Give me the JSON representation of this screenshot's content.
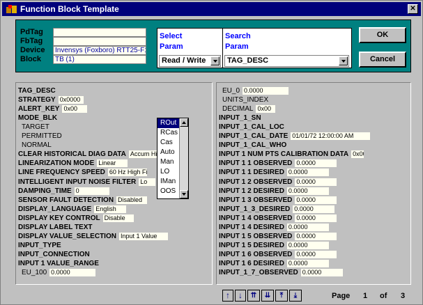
{
  "window": {
    "title": "Function Block Template",
    "close": "✕"
  },
  "header": {
    "pdtag_label": "PdTag",
    "fbtag_label": "FbTag",
    "device_label": "Device",
    "block_label": "Block",
    "pdtag_value": "",
    "fbtag_value": "",
    "device_value": "Invensys (Foxboro) RTT25-F1.",
    "block_value": "TB (1)",
    "select_head1": "Select",
    "select_head2": "Param",
    "select_value": "Read / Write",
    "search_head1": "Search",
    "search_head2": "Param",
    "search_value": "TAG_DESC",
    "ok": "OK",
    "cancel": "Cancel"
  },
  "left": [
    {
      "label": "TAG_DESC",
      "value": "",
      "bold": true
    },
    {
      "label": "STRATEGY",
      "value": "0x0000",
      "bold": true
    },
    {
      "label": "ALERT_KEY",
      "value": "0x00",
      "bold": true
    },
    {
      "label": "MODE_BLK",
      "value": "",
      "bold": true
    },
    {
      "label": "TARGET",
      "value": "",
      "bold": false
    },
    {
      "label": "PERMITTED",
      "value": "",
      "bold": false
    },
    {
      "label": "NORMAL",
      "value": "",
      "bold": false
    },
    {
      "label": "CLEAR HISTORICAL DIAG DATA",
      "value": "Accum Historica",
      "bold": true
    },
    {
      "label": "LINEARIZATION MODE",
      "value": "Linear",
      "bold": true
    },
    {
      "label": "LINE FREQUENCY SPEED",
      "value": "60 Hz High Fi",
      "bold": true
    },
    {
      "label": "INTELLIGENT INPUT NOISE FILTER",
      "value": "Lo",
      "bold": true
    },
    {
      "label": "DAMPING_TIME",
      "value": "0",
      "bold": true
    },
    {
      "label": "SENSOR FAULT DETECTION",
      "value": "Disabled",
      "bold": true
    },
    {
      "label": "DISPLAY_LANGUAGE",
      "value": "English",
      "bold": true
    },
    {
      "label": "DISPLAY KEY CONTROL",
      "value": "Disable",
      "bold": true
    },
    {
      "label": "DISPLAY LABEL TEXT",
      "value": "",
      "bold": true
    },
    {
      "label": "DISPLAY VALUE_SELECTION",
      "value": "Input 1 Value",
      "bold": true
    },
    {
      "label": "INPUT_TYPE",
      "value": "",
      "bold": true
    },
    {
      "label": "INPUT_CONNECTION",
      "value": "",
      "bold": true
    },
    {
      "label": "INPUT 1 VALUE_RANGE",
      "value": "",
      "bold": true
    },
    {
      "label": "EU_100",
      "value": "0.0000",
      "bold": false
    }
  ],
  "right": [
    {
      "label": "EU_0",
      "value": "0.0000",
      "bold": false
    },
    {
      "label": "UNITS_INDEX",
      "value": "",
      "bold": false
    },
    {
      "label": "DECIMAL",
      "value": "0x00",
      "bold": false
    },
    {
      "label": "INPUT_1_SN",
      "value": "",
      "bold": true
    },
    {
      "label": "INPUT_1_CAL_LOC",
      "value": "",
      "bold": true
    },
    {
      "label": "INPUT_1_CAL_DATE",
      "value": "01/01/72 12:00:00 AM",
      "bold": true
    },
    {
      "label": "INPUT_1_CAL_WHO",
      "value": "",
      "bold": true
    },
    {
      "label": "INPUT 1 NUM PTS CALIBRATION DATA",
      "value": "0x00",
      "bold": true
    },
    {
      "label": "INPUT 1 1 OBSERVED",
      "value": "0.0000",
      "bold": true
    },
    {
      "label": "INPUT 1 1 DESIRED",
      "value": "0.0000",
      "bold": true
    },
    {
      "label": "INPUT 1 2 OBSERVED",
      "value": "0.0000",
      "bold": true
    },
    {
      "label": "INPUT 1 2 DESIRED",
      "value": "0.0000",
      "bold": true
    },
    {
      "label": "INPUT 1 3 OBSERVED",
      "value": "0.0000",
      "bold": true
    },
    {
      "label": "INPUT_1_3_DESIRED",
      "value": "0.0000",
      "bold": true
    },
    {
      "label": "INPUT 1 4 OBSERVED",
      "value": "0.0000",
      "bold": true
    },
    {
      "label": "INPUT 1 4 DESIRED",
      "value": "0.0000",
      "bold": true
    },
    {
      "label": "INPUT 1 5 OBSERVED",
      "value": "0.0000",
      "bold": true
    },
    {
      "label": "INPUT 1 5 DESIRED",
      "value": "0.0000",
      "bold": true
    },
    {
      "label": "INPUT 1 6 OBSERVED",
      "value": "0.0000",
      "bold": true
    },
    {
      "label": "INPUT 1 6 DESIRED",
      "value": "0.0000",
      "bold": true
    },
    {
      "label": "INPUT_1_7_OBSERVED",
      "value": "0.0000",
      "bold": true
    }
  ],
  "mode_dropdown": {
    "options": [
      "ROut",
      "RCas",
      "Cas",
      "Auto",
      "Man",
      "LO",
      "IMan",
      "OOS"
    ],
    "selected": "ROut"
  },
  "pager": {
    "page_label": "Page",
    "page": "1",
    "of_label": "of",
    "total": "3"
  },
  "colors": {
    "title_bar": "#00007b",
    "header_bg": "#008080",
    "field_bg": "#fffff0"
  }
}
